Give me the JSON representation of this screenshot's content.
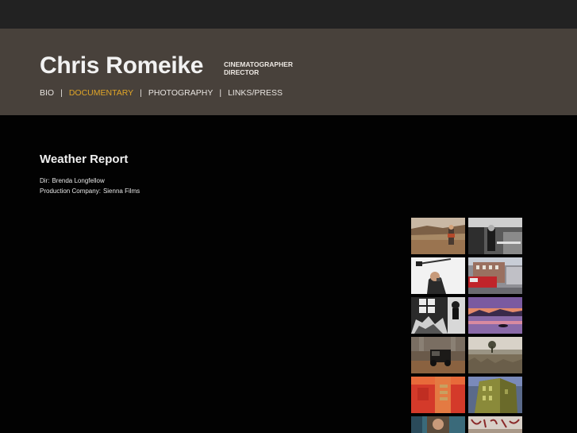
{
  "site": {
    "title": "Chris Romeike",
    "roles": [
      "CINEMATOGRAPHER",
      "DIRECTOR"
    ]
  },
  "nav": {
    "items": [
      {
        "label": "BIO",
        "active": false
      },
      {
        "label": "DOCUMENTARY",
        "active": true
      },
      {
        "label": "PHOTOGRAPHY",
        "active": false
      },
      {
        "label": "LINKS/PRESS",
        "active": false
      }
    ],
    "separator": "|"
  },
  "project": {
    "title": "Weather Report",
    "director_label": "Dir:",
    "director": "Brenda Longfellow",
    "company_label": "Production Company:",
    "company": "Sienna Films"
  },
  "thumbnails": [
    {
      "name": "desert-person"
    },
    {
      "name": "bw-market"
    },
    {
      "name": "man-microphone"
    },
    {
      "name": "firetruck-street"
    },
    {
      "name": "bw-crowd"
    },
    {
      "name": "sunset-lake"
    },
    {
      "name": "truck-field"
    },
    {
      "name": "grassland-tree"
    },
    {
      "name": "red-wall"
    },
    {
      "name": "green-building"
    },
    {
      "name": "person-partial"
    },
    {
      "name": "sign-partial"
    }
  ],
  "colors": {
    "accent": "#e0a528",
    "header_bg": "#48413b",
    "topbar_bg": "#222222",
    "page_bg": "#020202"
  }
}
